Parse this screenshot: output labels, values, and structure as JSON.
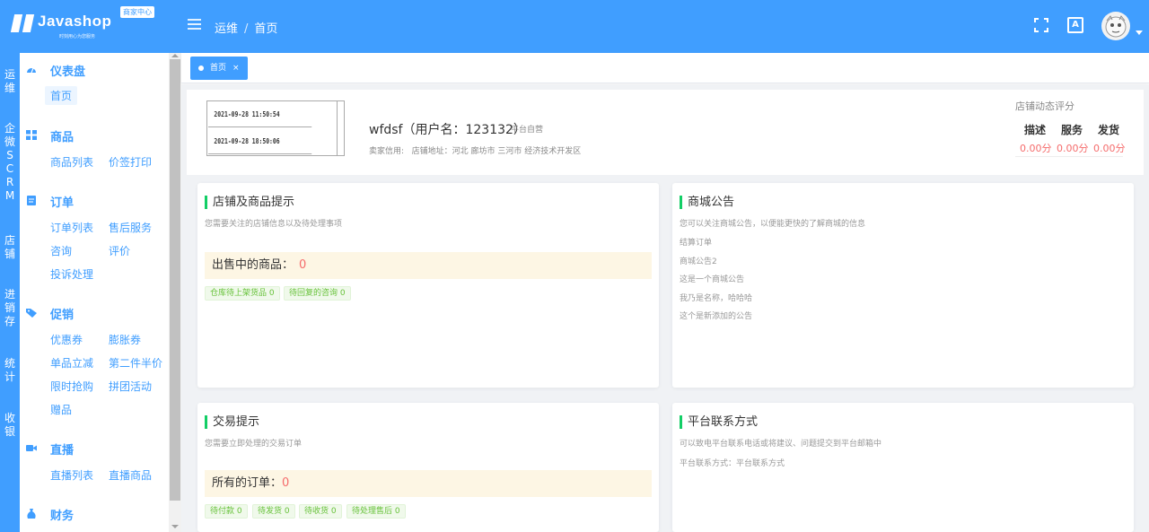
{
  "header": {
    "logo_text": "Javashop",
    "logo_sub": "时刻用心为您服务",
    "badge": "商家中心",
    "breadcrumb": [
      "运维",
      "首页"
    ],
    "colors": {
      "primary": "#409eff"
    }
  },
  "rail": {
    "items": [
      "运维",
      "企微SCRM",
      "店铺",
      "进销存",
      "统计",
      "收银"
    ]
  },
  "sidebar": {
    "groups": [
      {
        "title": "仪表盘",
        "icon": "dashboard-icon",
        "items": [
          "首页"
        ]
      },
      {
        "title": "商品",
        "icon": "grid-icon",
        "items": [
          "商品列表",
          "价签打印"
        ]
      },
      {
        "title": "订单",
        "icon": "clipboard-icon",
        "items": [
          "订单列表",
          "售后服务",
          "咨询",
          "评价",
          "投诉处理"
        ]
      },
      {
        "title": "促销",
        "icon": "tag-icon",
        "items": [
          "优惠券",
          "膨胀券",
          "单品立减",
          "第二件半价",
          "限时抢购",
          "拼团活动",
          "赠品"
        ]
      },
      {
        "title": "直播",
        "icon": "video-icon",
        "items": [
          "直播列表",
          "直播商品"
        ]
      },
      {
        "title": "财务",
        "icon": "money-bag-icon",
        "items": []
      }
    ]
  },
  "tabs": [
    {
      "label": "首页",
      "close": "×"
    }
  ],
  "shop": {
    "thumb_lines": [
      "2021-09-28 11:50:54",
      "2021-09-28 18:50:06"
    ],
    "name": "wfdsf（用户名：123132）",
    "type": "平台自营",
    "credit_label": "卖家信用:",
    "address": "店铺地址：河北 廊坊市 三河市 经济技术开发区",
    "score_title": "店铺动态评分",
    "scores": [
      {
        "label": "描述",
        "value": "0.00分"
      },
      {
        "label": "服务",
        "value": "0.00分"
      },
      {
        "label": "发货",
        "value": "0.00分"
      }
    ]
  },
  "cards": {
    "goods_tips": {
      "title": "店铺及商品提示",
      "subtitle": "您需要关注的店铺信息以及待处理事项",
      "highlight_label": "出售中的商品：",
      "highlight_value": "0",
      "chips": [
        "仓库待上架货品 0",
        "待回复的咨询 0"
      ]
    },
    "notices": {
      "title": "商城公告",
      "subtitle": "您可以关注商城公告，以便能更快的了解商城的信息",
      "items": [
        "结算订单",
        "商城公告2",
        "这是一个商城公告",
        "我乃是名称，哈哈哈",
        "这个是新添加的公告"
      ]
    },
    "trade_tips": {
      "title": "交易提示",
      "subtitle": "您需要立即处理的交易订单",
      "highlight_label": "所有的订单：",
      "highlight_value": "0",
      "chips": [
        "待付款 0",
        "待发货 0",
        "待收货 0",
        "待处理售后 0"
      ]
    },
    "contact": {
      "title": "平台联系方式",
      "subtitle": "可以致电平台联系电话或将建议、问题提交到平台邮箱中",
      "line": "平台联系方式：平台联系方式"
    }
  }
}
